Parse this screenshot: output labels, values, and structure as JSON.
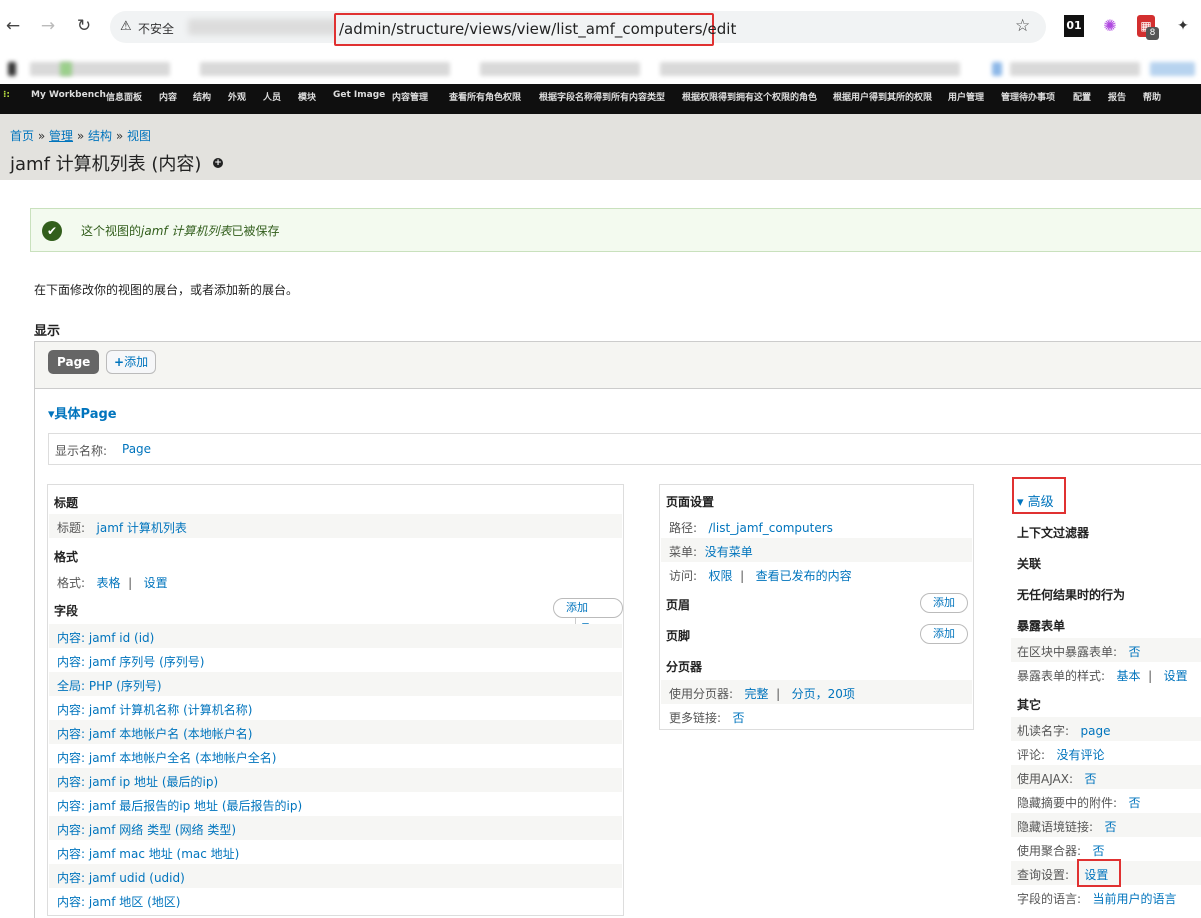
{
  "browser": {
    "security_label": "不安全",
    "url": "/admin/structure/views/view/list_amf_computers/edit",
    "ext_badge_count": "8",
    "ext_01": "01"
  },
  "toolbar": [
    "My Workbench",
    "信息面板",
    "内容",
    "结构",
    "外观",
    "人员",
    "模块",
    "Get Image",
    "内容管理",
    "查看所有角色权限",
    "根据字段名称得到所有内容类型",
    "根据权限得到拥有这个权限的角色",
    "根据用户得到其所的权限",
    "用户管理",
    "管理待办事项",
    "配置",
    "报告",
    "帮助"
  ],
  "breadcrumb": {
    "home": "首页",
    "admin": "管理",
    "structure": "结构",
    "views": "视图",
    "sep": "»"
  },
  "page_title": "jamf 计算机列表 (内容)",
  "status": {
    "prefix": "这个视图的",
    "name": "jamf 计算机列表",
    "suffix": "已被保存"
  },
  "intro": "在下面修改你的视图的展台，或者添加新的展台。",
  "display_heading": "显示",
  "tabs": {
    "page": "Page",
    "add": "添加"
  },
  "details_title": "具体Page",
  "display_name": {
    "label": "显示名称:",
    "value": "Page"
  },
  "left": {
    "title_section": "标题",
    "title_label": "标题:",
    "title_value": "jamf 计算机列表",
    "format_section": "格式",
    "format_label": "格式:",
    "format_value": "表格",
    "format_settings": "设置",
    "fields_section": "字段",
    "fields_add": "添加",
    "fields": [
      "内容: jamf id (id)",
      "内容: jamf 序列号 (序列号)",
      "全局: PHP (序列号)",
      "内容: jamf 计算机名称 (计算机名称)",
      "内容: jamf 本地帐户名 (本地帐户名)",
      "内容: jamf 本地帐户全名 (本地帐户全名)",
      "内容: jamf ip 地址 (最后的ip)",
      "内容: jamf 最后报告的ip 地址 (最后报告的ip)",
      "内容: jamf 网络 类型 (网络 类型)",
      "内容: jamf mac 地址 (mac 地址)",
      "内容: jamf udid (udid)",
      "内容: jamf 地区 (地区)"
    ]
  },
  "middle": {
    "page_settings": "页面设置",
    "path_label": "路径:",
    "path_value": "/list_jamf_computers",
    "menu_label": "菜单:",
    "menu_value": "没有菜单",
    "access_label": "访问:",
    "access_value": "权限",
    "access_value2": "查看已发布的内容",
    "header": "页眉",
    "footer": "页脚",
    "add": "添加",
    "pager": "分页器",
    "pager_label": "使用分页器:",
    "pager_value": "完整",
    "pager_value2": "分页，20项",
    "more_label": "更多链接:",
    "more_value": "否"
  },
  "right": {
    "advanced": "高级",
    "context_filters": "上下文过滤器",
    "relationships": "关联",
    "no_results": "无任何结果时的行为",
    "exposed_form": "暴露表单",
    "exposed_block_label": "在区块中暴露表单:",
    "exposed_block_value": "否",
    "exposed_style_label": "暴露表单的样式:",
    "exposed_style_value": "基本",
    "exposed_style_settings": "设置",
    "other": "其它",
    "machine_label": "机读名字:",
    "machine_value": "page",
    "comment_label": "评论:",
    "comment_value": "没有评论",
    "ajax_label": "使用AJAX:",
    "ajax_value": "否",
    "hide_att_label": "隐藏摘要中的附件:",
    "hide_att_value": "否",
    "hide_ctx_label": "隐藏语境链接:",
    "hide_ctx_value": "否",
    "agg_label": "使用聚合器:",
    "agg_value": "否",
    "query_label": "查询设置:",
    "query_value": "设置",
    "lang_label": "字段的语言:",
    "lang_value": "当前用户的语言"
  }
}
